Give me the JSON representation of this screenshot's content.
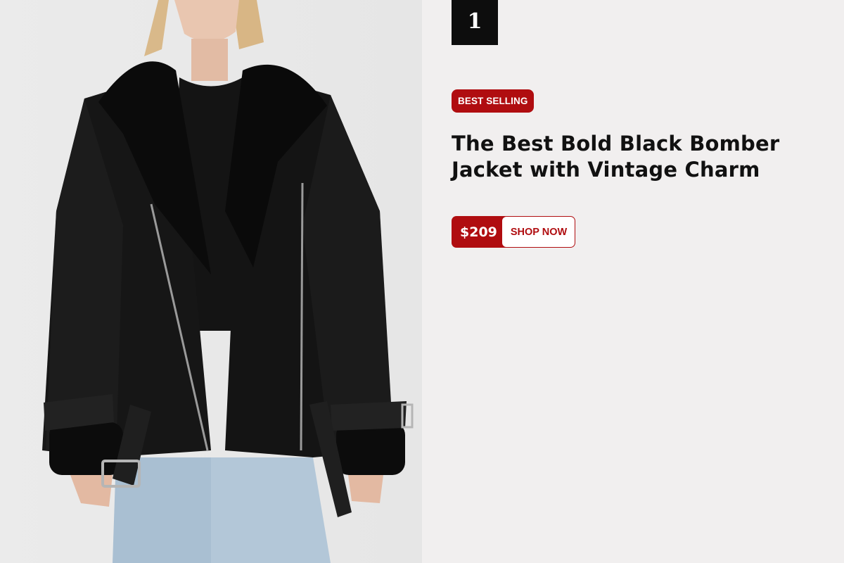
{
  "product": {
    "rank": "1",
    "badge": "BEST SELLING",
    "title": "The Best Bold Black Bomber Jacket with Vintage Charm",
    "price": "$209",
    "cta_label": "SHOP NOW",
    "image_alt": "Woman wearing a black shearling-lined bomber jacket with light blue jeans"
  },
  "colors": {
    "accent": "#b00d10",
    "rank_box": "#0d0d0d",
    "background": "#f1efef"
  }
}
